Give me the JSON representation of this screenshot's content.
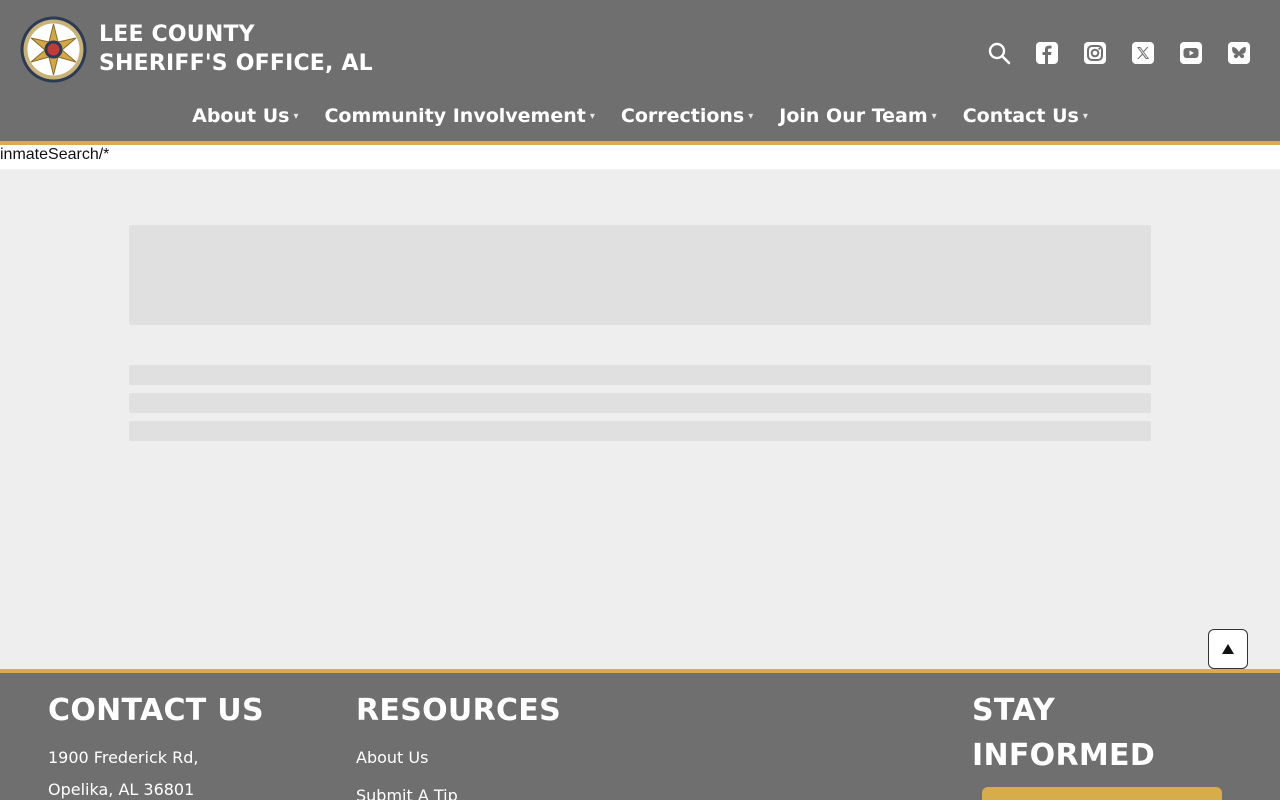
{
  "header": {
    "brand_line1": "LEE COUNTY",
    "brand_line2": "SHERIFF'S OFFICE, AL",
    "logo": "sheriff-star-seal",
    "icons": [
      "search-icon",
      "facebook-icon",
      "instagram-icon",
      "x-twitter-icon",
      "youtube-icon",
      "bluesky-icon"
    ]
  },
  "nav": {
    "items": [
      {
        "label": "About Us"
      },
      {
        "label": "Community Involvement"
      },
      {
        "label": "Corrections"
      },
      {
        "label": "Join Our Team"
      },
      {
        "label": "Contact Us"
      }
    ],
    "caret": "▾"
  },
  "route_text": "inmateSearch/*",
  "footer": {
    "contact": {
      "heading": "CONTACT US",
      "address_line1": "1900 Frederick Rd,",
      "address_line2": "Opelika, AL 36801"
    },
    "resources": {
      "heading": "RESOURCES",
      "links": [
        "About Us",
        "Submit A Tip"
      ]
    },
    "stay_informed": {
      "heading_line1": "STAY",
      "heading_line2": "INFORMED"
    }
  },
  "colors": {
    "header_bg": "#6f6f6f",
    "accent_gold": "#d7ad4b",
    "page_bg": "#eeeeee",
    "skeleton": "#e0e0e0"
  }
}
